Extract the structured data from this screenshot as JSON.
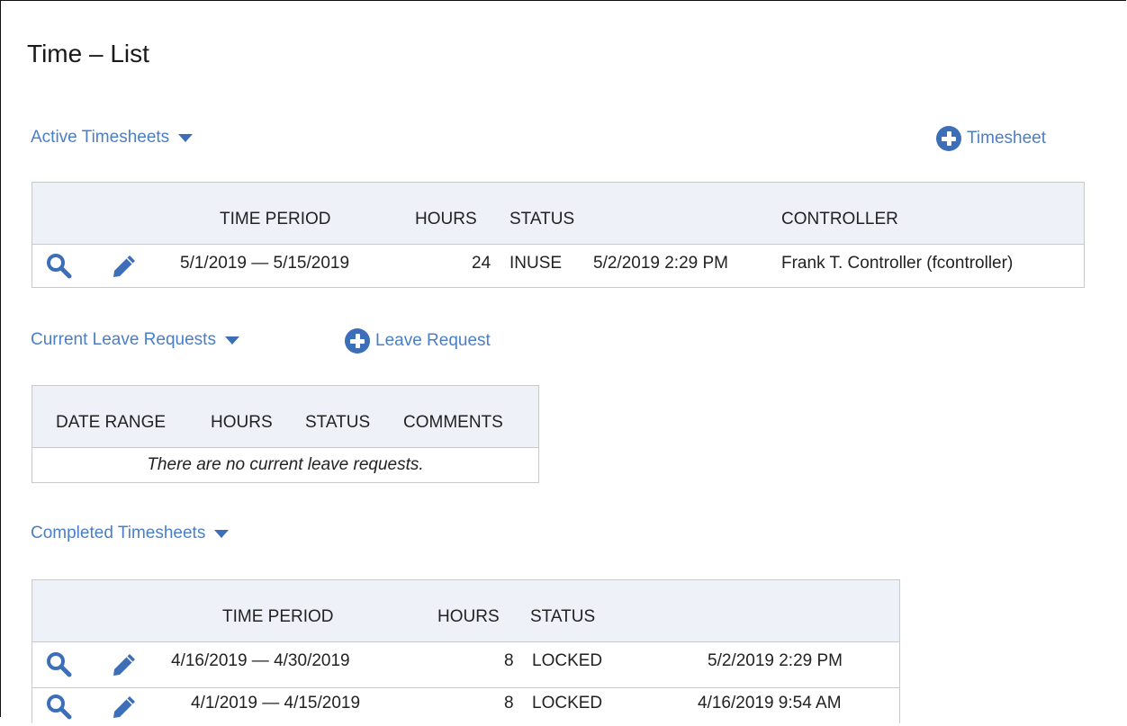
{
  "page": {
    "title": "Time – List"
  },
  "active": {
    "link_label": "Active Timesheets",
    "add_label": "Timesheet",
    "headers": {
      "time_period": "TIME PERIOD",
      "hours": "HOURS",
      "status": "STATUS",
      "controller": "CONTROLLER"
    },
    "rows": [
      {
        "period": "5/1/2019 — 5/15/2019",
        "hours": "24",
        "status": "INUSE",
        "updated": "5/2/2019 2:29 PM",
        "controller": "Frank T. Controller (fcontroller)"
      }
    ]
  },
  "leave": {
    "link_label": "Current Leave Requests",
    "add_label": "Leave Request",
    "headers": {
      "date_range": "DATE RANGE",
      "hours": "HOURS",
      "status": "STATUS",
      "comments": "COMMENTS"
    },
    "empty_message": "There are no current leave requests."
  },
  "completed": {
    "link_label": "Completed Timesheets",
    "headers": {
      "time_period": "TIME PERIOD",
      "hours": "HOURS",
      "status": "STATUS"
    },
    "rows": [
      {
        "period": "4/16/2019 — 4/30/2019",
        "hours": "8",
        "status": "LOCKED",
        "updated": "5/2/2019 2:29 PM"
      },
      {
        "period": "4/1/2019 — 4/15/2019",
        "hours": "8",
        "status": "LOCKED",
        "updated": "4/16/2019 9:54 AM"
      }
    ]
  },
  "colors": {
    "link": "#4a7fc8",
    "icon": "#3d6fb8",
    "header_bg": "#eff1f8",
    "border": "#c9c9c9"
  },
  "icons": {
    "view": "magnifier-icon",
    "edit": "pencil-icon",
    "add": "plus-circle-icon",
    "expand": "caret-down-icon"
  }
}
